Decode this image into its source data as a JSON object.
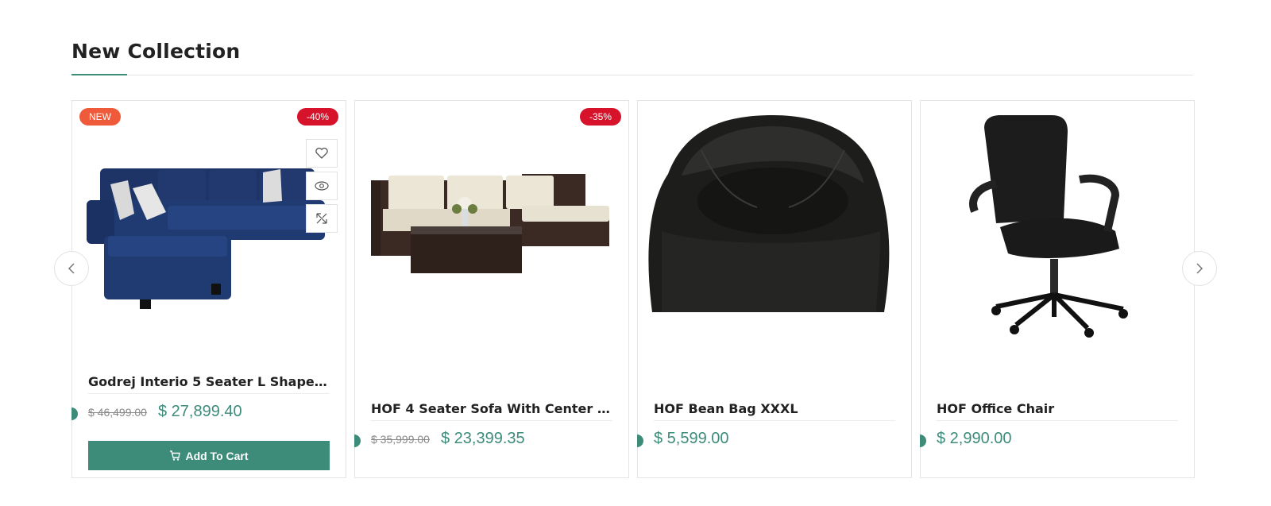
{
  "section": {
    "title": "New Collection"
  },
  "colors": {
    "accent": "#3d8c7a",
    "badge_new": "#ef5b3a",
    "badge_discount": "#d7132c"
  },
  "products": [
    {
      "name": "Godrej Interio 5 Seater L Shape Sofa ...",
      "badge_new": "NEW",
      "discount": "-40%",
      "old_price": "$ 46,499.00",
      "price": "$ 27,899.40",
      "cart_label": "Add To Cart",
      "actions": [
        "heart-icon",
        "eye-icon",
        "compare-icon"
      ]
    },
    {
      "name": "HOF 4 Seater Sofa With Center Table",
      "discount": "-35%",
      "old_price": "$ 35,999.00",
      "price": "$ 23,399.35"
    },
    {
      "name": "HOF Bean Bag XXXL",
      "price": "$ 5,599.00"
    },
    {
      "name": "HOF Office Chair",
      "price": "$ 2,990.00"
    }
  ],
  "nav": {
    "prev": "chevron-left-icon",
    "next": "chevron-right-icon"
  }
}
